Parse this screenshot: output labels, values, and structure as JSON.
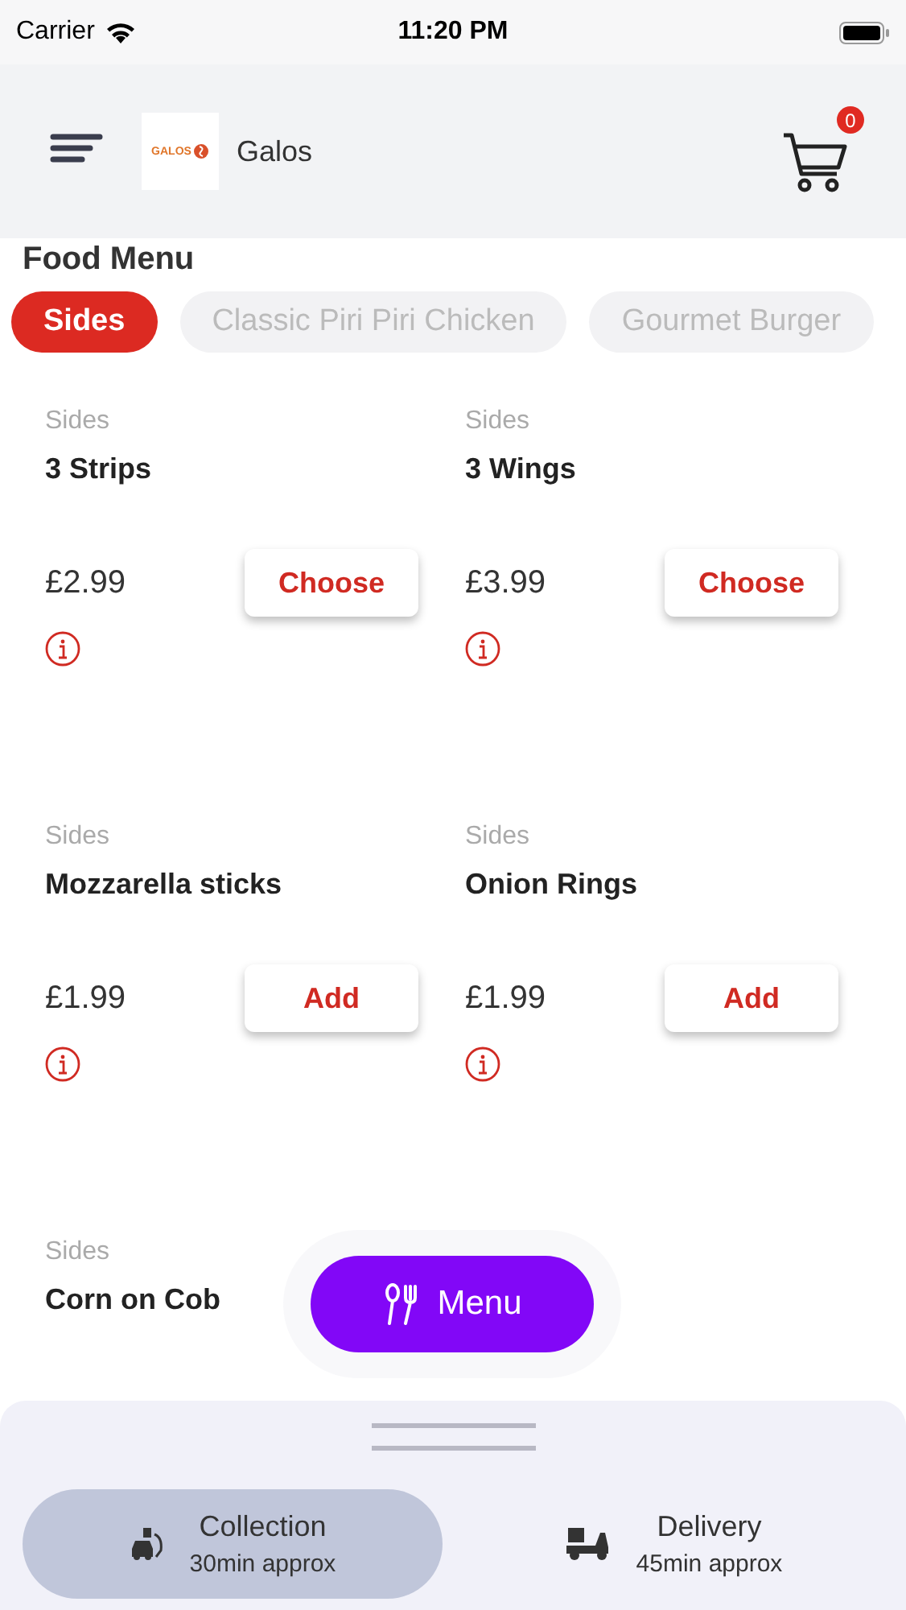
{
  "status_bar": {
    "carrier": "Carrier",
    "time": "11:20 PM"
  },
  "header": {
    "logo_text": "GALOS",
    "restaurant": "Galos",
    "cart_count": "0"
  },
  "title": "Food Menu",
  "tabs": [
    {
      "label": "Sides",
      "selected": true
    },
    {
      "label": "Classic Piri Piri Chicken",
      "selected": false
    },
    {
      "label": "Gourmet Burger",
      "selected": false
    }
  ],
  "items": [
    {
      "category": "Sides",
      "name": "3 Strips",
      "price": "£2.99",
      "button": "Choose"
    },
    {
      "category": "Sides",
      "name": "3 Wings",
      "price": "£3.99",
      "button": "Choose"
    },
    {
      "category": "Sides",
      "name": "Mozzarella sticks",
      "price": "£1.99",
      "button": "Add"
    },
    {
      "category": "Sides",
      "name": "Onion Rings",
      "price": "£1.99",
      "button": "Add"
    },
    {
      "category": "Sides",
      "name": "Corn on Cob"
    }
  ],
  "menu_button": {
    "label": "Menu"
  },
  "order_modes": [
    {
      "kind": "collection",
      "label": "Collection",
      "time": "30min approx",
      "selected": true
    },
    {
      "kind": "delivery",
      "label": "Delivery",
      "time": "45min approx",
      "selected": false
    }
  ]
}
